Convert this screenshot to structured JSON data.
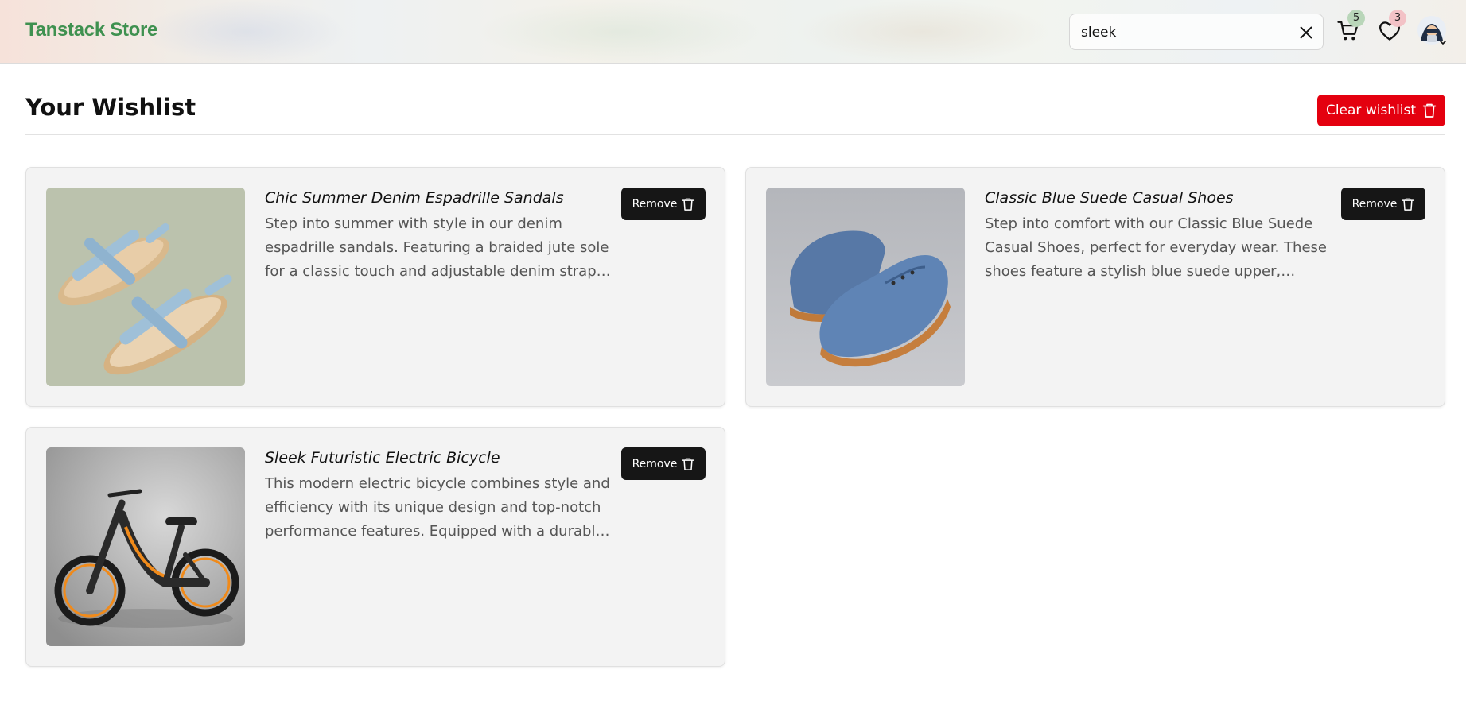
{
  "header": {
    "logo": "Tanstack Store",
    "search": {
      "value": "sleek",
      "placeholder": ""
    },
    "cart_count": "5",
    "wishlist_count": "3"
  },
  "page": {
    "title": "Your Wishlist",
    "clear_label": "Clear wishlist"
  },
  "items": [
    {
      "name": "Chic Summer Denim Espadrille Sandals",
      "description": "Step into summer with style in our denim espadrille sandals. Featuring a braided jute sole for a classic touch and adjustable denim straps for a comfortable fit.",
      "remove_label": "Remove"
    },
    {
      "name": "Classic Blue Suede Casual Shoes",
      "description": "Step into comfort with our Classic Blue Suede Casual Shoes, perfect for everyday wear. These shoes feature a stylish blue suede upper, durable rubber sole.",
      "remove_label": "Remove"
    },
    {
      "name": "Sleek Futuristic Electric Bicycle",
      "description": "This modern electric bicycle combines style and efficiency with its unique design and top-notch performance features. Equipped with a durable frame.",
      "remove_label": "Remove"
    }
  ],
  "colors": {
    "brand": "#3f9150",
    "danger": "#e4000f",
    "remove_button": "#161616",
    "card_bg": "#f3f3f3"
  },
  "icons": [
    "close-icon",
    "cart-icon",
    "heart-icon",
    "avatar-icon",
    "chevron-down-icon",
    "trash-icon"
  ]
}
